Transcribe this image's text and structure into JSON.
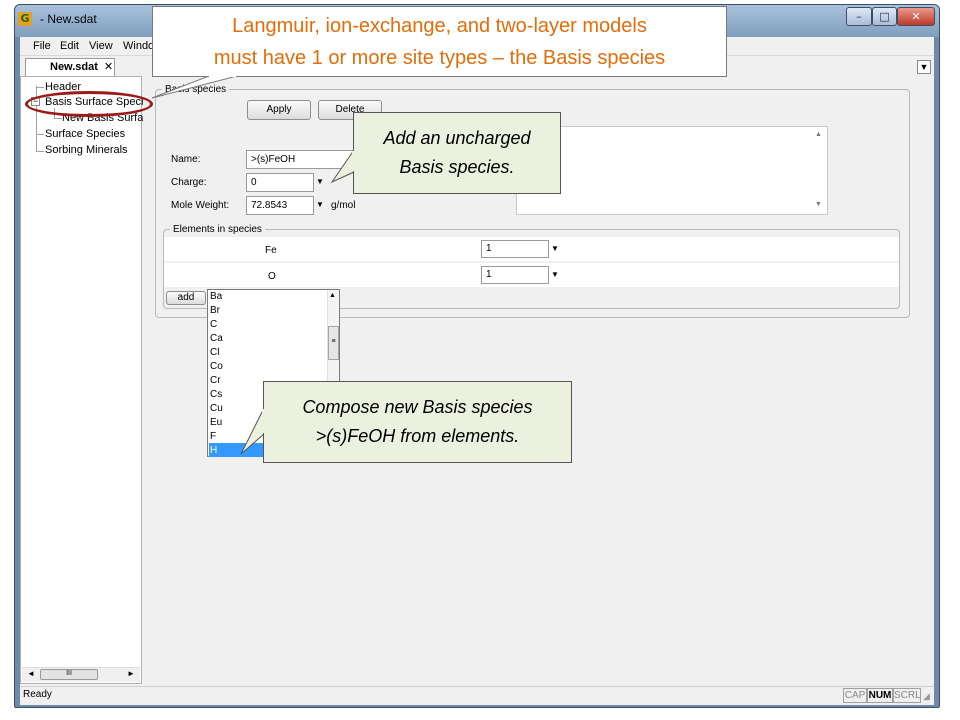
{
  "window": {
    "app_icon_glyph": "G",
    "title": "- New.sdat",
    "minimize": "–",
    "maximize": "□",
    "close": "✕"
  },
  "menu": [
    "File",
    "Edit",
    "View",
    "Windo"
  ],
  "document_tab": {
    "label": "New.sdat",
    "close": "✕"
  },
  "tree": {
    "items": [
      {
        "label": "Header"
      },
      {
        "label": "Basis Surface Specie"
      },
      {
        "label": "New Basis Surfac"
      },
      {
        "label": "Surface Species"
      },
      {
        "label": "Sorbing Minerals"
      }
    ],
    "expander": "−",
    "hscroll_thumb": "III"
  },
  "basis_species": {
    "group_label": "Basis species",
    "apply_label": "Apply",
    "delete_label": "Delete",
    "name_label": "Name:",
    "name_value": ">(s)FeOH",
    "charge_label": "Charge:",
    "charge_value": "0",
    "mole_weight_label": "Mole Weight:",
    "mole_weight_value": "72.8543",
    "mole_weight_unit": "g/mol"
  },
  "elements_group": {
    "label": "Elements in species",
    "rows": [
      {
        "element": "Fe",
        "count": "1"
      },
      {
        "element": "O",
        "count": "1"
      }
    ],
    "add_label": "add"
  },
  "element_list": {
    "items": [
      "Ba",
      "Br",
      "C",
      "Ca",
      "Cl",
      "Co",
      "Cr",
      "Cs",
      "Cu",
      "Eu",
      "F",
      "H"
    ],
    "selected": "H"
  },
  "status": {
    "text": "Ready",
    "cap": "CAP",
    "num": "NUM",
    "scrl": "SCRL"
  },
  "callouts": {
    "banner_line1": "Langmuir, ion-exchange, and two-layer models",
    "banner_line2": "must have 1 or more site types – the Basis species",
    "uncharged_line1": "Add an uncharged",
    "uncharged_line2": "Basis species.",
    "compose_line1": "Compose new Basis species",
    "compose_line2": ">(s)FeOH from elements."
  },
  "colors": {
    "banner_text": "#e46c0a",
    "callout_fill": "#ebf1de",
    "highlight_ellipse": "#9b1b1b",
    "selection": "#3399ff"
  }
}
